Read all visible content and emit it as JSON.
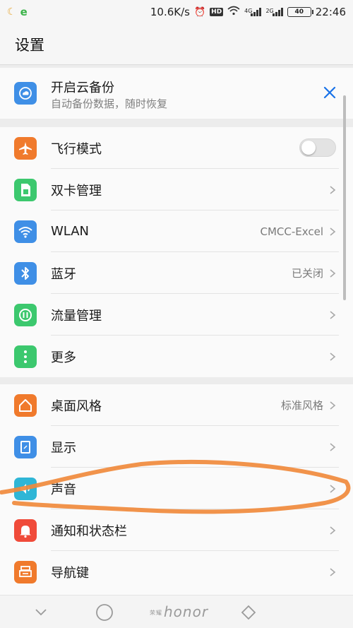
{
  "status_bar": {
    "network_speed": "10.6K/s",
    "hd_badge": "HD",
    "sim1_tag": "4G",
    "sim2_tag": "2G",
    "battery": "40",
    "time": "22:46"
  },
  "header": {
    "title": "设置"
  },
  "backup_card": {
    "title": "开启云备份",
    "subtitle": "自动备份数据，随时恢复",
    "icon": "cloud-backup-icon"
  },
  "settings_main": [
    {
      "label": "飞行模式",
      "icon": "airplane-icon",
      "color": "#f07a2c",
      "value": "",
      "control": "toggle",
      "toggle_on": false
    },
    {
      "label": "双卡管理",
      "icon": "sim-card-icon",
      "color": "#3cc86e",
      "value": "",
      "control": "chevron"
    },
    {
      "label": "WLAN",
      "icon": "wifi-icon",
      "color": "#3f8fe6",
      "value": "CMCC-Excel",
      "control": "chevron"
    },
    {
      "label": "蓝牙",
      "icon": "bluetooth-icon",
      "color": "#3f8fe6",
      "value": "已关闭",
      "control": "chevron"
    },
    {
      "label": "流量管理",
      "icon": "data-usage-icon",
      "color": "#3cc86e",
      "value": "",
      "control": "chevron"
    },
    {
      "label": "更多",
      "icon": "more-dots-icon",
      "color": "#3cc86e",
      "value": "",
      "control": "chevron"
    }
  ],
  "settings_display": [
    {
      "label": "桌面风格",
      "icon": "home-style-icon",
      "color": "#f07a2c",
      "value": "标准风格",
      "control": "chevron"
    },
    {
      "label": "显示",
      "icon": "display-icon",
      "color": "#3f8fe6",
      "value": "",
      "control": "chevron"
    },
    {
      "label": "声音",
      "icon": "speaker-icon",
      "color": "#2fb6d6",
      "value": "",
      "control": "chevron"
    },
    {
      "label": "通知和状态栏",
      "icon": "bell-icon",
      "color": "#f04b3a",
      "value": "",
      "control": "chevron"
    },
    {
      "label": "导航键",
      "icon": "navigation-key-icon",
      "color": "#f07a2c",
      "value": "",
      "control": "chevron"
    }
  ],
  "nav_bar": {
    "brand": "honor",
    "brand_tag": "荣耀"
  },
  "colors": {
    "accent": "#1a73e8",
    "annotation": "#f08a3c",
    "background": "#ececec"
  }
}
